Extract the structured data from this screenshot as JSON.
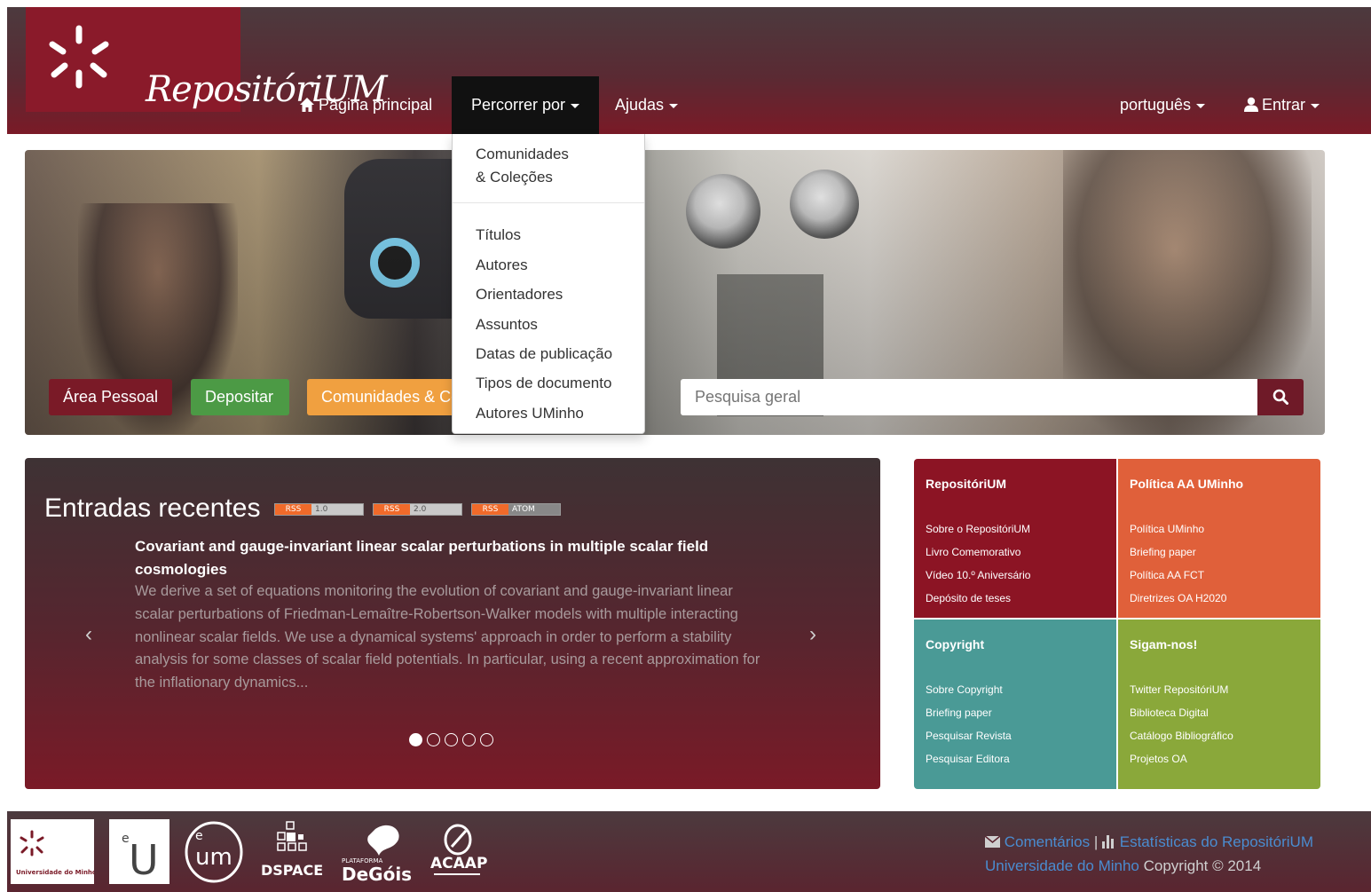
{
  "header": {
    "logo_text": "RepositóriUM",
    "nav": {
      "home": "Página principal",
      "browse": "Percorrer por",
      "help": "Ajudas",
      "language": "português",
      "login": "Entrar"
    }
  },
  "browse_menu": {
    "items": [
      "Comunidades",
      "& Coleções",
      "Títulos",
      "Autores",
      "Orientadores",
      "Assuntos",
      "Datas de publicação",
      "Tipos de documento",
      "Autores UMinho"
    ]
  },
  "hero": {
    "buttons": {
      "area": "Área Pessoal",
      "deposit": "Depositar",
      "communities": "Comunidades & Coleções"
    },
    "search": {
      "placeholder": "Pesquisa geral"
    }
  },
  "recent": {
    "title": "Entradas recentes",
    "feeds": [
      {
        "left": "RSS",
        "right": "1.0"
      },
      {
        "left": "RSS",
        "right": "2.0"
      },
      {
        "left": "RSS",
        "right": "ATOM"
      }
    ],
    "entry": {
      "title": "Covariant and gauge-invariant linear scalar perturbations in multiple scalar field cosmologies",
      "abstract": "We derive a set of equations monitoring the evolution of covariant and gauge-invariant linear scalar perturbations of Friedman-Lemaître-Robertson-Walker models with multiple interacting nonlinear scalar fields. We use a dynamical systems' approach in order to perform a stability analysis for some classes of scalar field potentials. In particular, using a recent approximation for the inflationary dynamics..."
    },
    "prev": "‹",
    "next": "›",
    "slides_total": 5,
    "slide_active": 1
  },
  "tiles": {
    "repo": {
      "title": "RepositóriUM",
      "links": [
        "Sobre o RepositóriUM",
        "Livro Comemorativo",
        "Vídeo 10.º Aniversário",
        "Depósito de teses"
      ]
    },
    "policy": {
      "title": "Política AA UMinho",
      "links": [
        "Política UMinho",
        "Briefing paper",
        "Política AA FCT",
        "Diretrizes OA H2020"
      ]
    },
    "copyright": {
      "title": "Copyright",
      "links": [
        "Sobre Copyright",
        "Briefing paper",
        "Pesquisar Revista",
        "Pesquisar Editora"
      ]
    },
    "follow": {
      "title": "Sigam-nos!",
      "links": [
        "Twitter RepositóriUM",
        "Biblioteca Digital",
        "Catálogo Bibliográfico",
        "Projetos OA"
      ]
    }
  },
  "footer": {
    "comments": "Comentários",
    "separator": "|",
    "stats": "Estatísticas do RepositóriUM",
    "university": "Universidade do Minho",
    "copyright": "Copyright © 2014",
    "logos": {
      "um_caption": "Universidade do Minho",
      "dspace": "DSPACE",
      "degois_small": "PLATAFORMA",
      "degois": "DeGóis",
      "acaap": "ACAAP"
    }
  },
  "colors": {
    "brand": "#7a1a27",
    "tile_repo": "#8c1424",
    "tile_policy": "#e0603a",
    "tile_copyright": "#4a9a96",
    "tile_follow": "#8aa83a",
    "link_blue": "#4a8cd0"
  }
}
